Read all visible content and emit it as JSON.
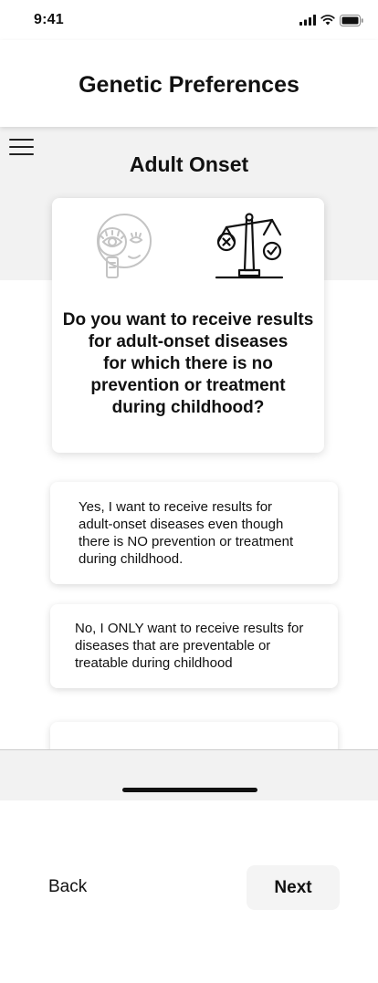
{
  "status_bar": {
    "time": "9:41",
    "icons": [
      "cellular-signal-icon",
      "wifi-icon",
      "battery-icon"
    ]
  },
  "header": {
    "title": "Genetic Preferences"
  },
  "section": {
    "title": "Adult Onset"
  },
  "question": {
    "lines": [
      "Do you want to receive results",
      "for adult-onset diseases",
      "for which there is no",
      "prevention or treatment",
      "during childhood?"
    ],
    "icons": [
      "eye-magnifier-icon",
      "balance-scale-icon"
    ]
  },
  "options": [
    {
      "lines": [
        "Yes, I want to receive results for",
        "adult-onset diseases even though",
        "there is NO prevention or treatment",
        "during childhood."
      ]
    },
    {
      "lines": [
        "No, I ONLY want to receive results for",
        "diseases that are preventable or",
        "treatable during childhood"
      ]
    }
  ],
  "footer": {
    "back_label": "Back",
    "next_label": "Next"
  },
  "colors": {
    "gray_band": "#f2f2f2",
    "next_button_bg": "#f4f4f4",
    "text": "#111111"
  }
}
